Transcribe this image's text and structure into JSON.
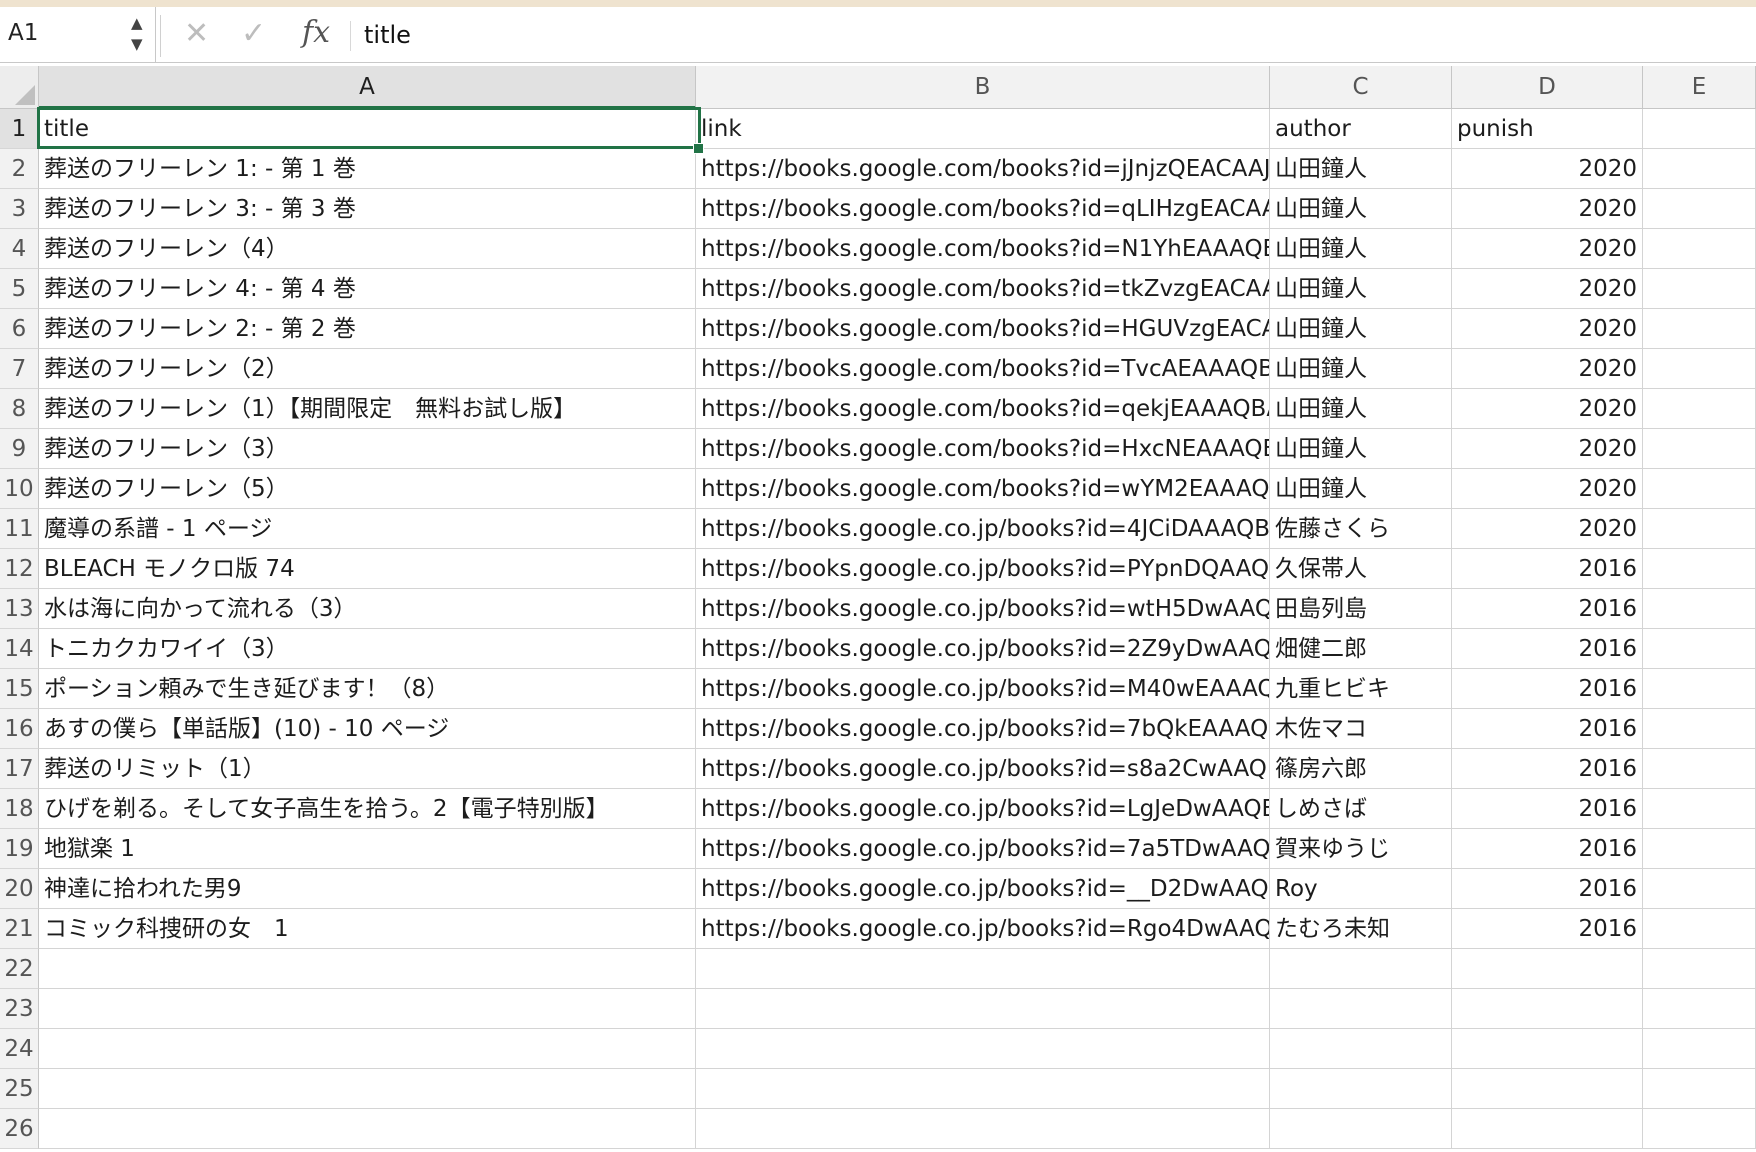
{
  "formula_bar": {
    "name_box": "A1",
    "cancel_icon": "✕",
    "confirm_icon": "✓",
    "fx_label": "fx",
    "content": "title"
  },
  "grid": {
    "columns": [
      "A",
      "B",
      "C",
      "D",
      "E"
    ],
    "selected_cell": "A1",
    "data_row_count": 21,
    "total_rows": 26,
    "rows": [
      [
        "title",
        "link",
        "author",
        "punish"
      ],
      [
        "葬送のフリーレン 1: - 第 1 巻",
        "https://books.google.com/books?id=jJnjzQEACAAJ",
        "山田鐘人",
        "2020"
      ],
      [
        "葬送のフリーレン 3: - 第 3 巻",
        "https://books.google.com/books?id=qLIHzgEACAA",
        "山田鐘人",
        "2020"
      ],
      [
        "葬送のフリーレン（4）",
        "https://books.google.com/books?id=N1YhEAAAQE",
        "山田鐘人",
        "2020"
      ],
      [
        "葬送のフリーレン 4: - 第 4 巻",
        "https://books.google.com/books?id=tkZvzgEACAA",
        "山田鐘人",
        "2020"
      ],
      [
        "葬送のフリーレン 2: - 第 2 巻",
        "https://books.google.com/books?id=HGUVzgEACA",
        "山田鐘人",
        "2020"
      ],
      [
        "葬送のフリーレン（2）",
        "https://books.google.com/books?id=TvcAEAAAQB",
        "山田鐘人",
        "2020"
      ],
      [
        "葬送のフリーレン（1）【期間限定　無料お試し版】",
        "https://books.google.com/books?id=qekjEAAAQBA",
        "山田鐘人",
        "2020"
      ],
      [
        "葬送のフリーレン（3）",
        "https://books.google.com/books?id=HxcNEAAAQB",
        "山田鐘人",
        "2020"
      ],
      [
        "葬送のフリーレン（5）",
        "https://books.google.com/books?id=wYM2EAAAQI",
        "山田鐘人",
        "2020"
      ],
      [
        "魔導の系譜 - 1 ページ",
        "https://books.google.co.jp/books?id=4JCiDAAAQB",
        "佐藤さくら",
        "2020"
      ],
      [
        "BLEACH モノクロ版 74",
        "https://books.google.co.jp/books?id=PYpnDQAAQ",
        "久保帯人",
        "2016"
      ],
      [
        "水は海に向かって流れる（3）",
        "https://books.google.co.jp/books?id=wtH5DwAAQ",
        "田島列島",
        "2016"
      ],
      [
        "トニカクカワイイ（3）",
        "https://books.google.co.jp/books?id=2Z9yDwAAQE",
        "畑健二郎",
        "2016"
      ],
      [
        "ポーション頼みで生き延びます！（8）",
        "https://books.google.co.jp/books?id=M40wEAAAQ",
        "九重ヒビキ",
        "2016"
      ],
      [
        "あすの僕ら【単話版】(10) - 10 ページ",
        "https://books.google.co.jp/books?id=7bQkEAAAQE",
        "木佐マコ",
        "2016"
      ],
      [
        "葬送のリミット（1）",
        "https://books.google.co.jp/books?id=s8a2CwAAQE",
        "篠房六郎",
        "2016"
      ],
      [
        "ひげを剃る。そして女子高生を拾う。2【電子特別版】",
        "https://books.google.co.jp/books?id=LgJeDwAAQE",
        "しめさば",
        "2016"
      ],
      [
        "地獄楽 1",
        "https://books.google.co.jp/books?id=7a5TDwAAQ",
        "賀来ゆうじ",
        "2016"
      ],
      [
        "神達に拾われた男9",
        "https://books.google.co.jp/books?id=__D2DwAAQI",
        "Roy",
        "2016"
      ],
      [
        "コミック科捜研の女　1",
        "https://books.google.co.jp/books?id=Rgo4DwAAQ",
        "たむろ未知",
        "2016"
      ]
    ]
  },
  "colors": {
    "selection": "#217346",
    "header_bg": "#f2f2f2",
    "gridline": "#d4d4d4"
  }
}
